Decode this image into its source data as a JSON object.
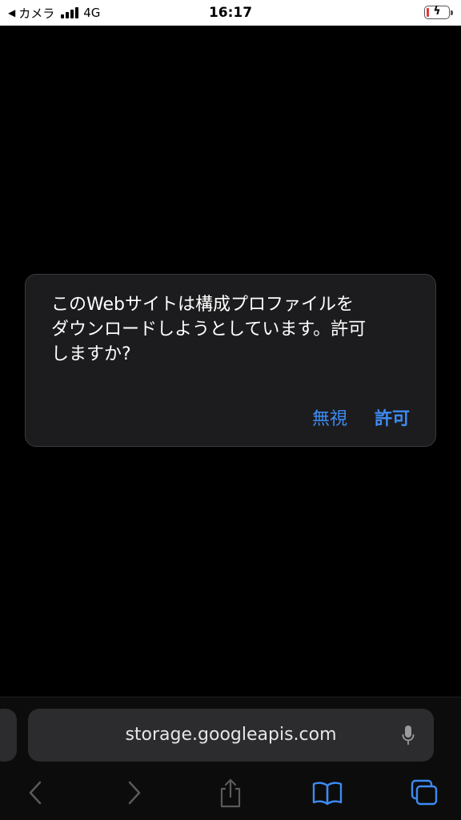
{
  "status_bar": {
    "back_glyph": "◀",
    "carrier": "カメラ",
    "network": "4G",
    "time": "16:17",
    "battery_level": 0.1,
    "charging": true
  },
  "dialog": {
    "message_lines": [
      "このWebサイトは構成プロファイルを",
      "ダウンロードしようとしています。許可",
      "しますか?"
    ],
    "ignore_label": "無視",
    "allow_label": "許可"
  },
  "browser": {
    "url": "storage.googleapis.com"
  },
  "toolbar": {
    "buttons": [
      "back-icon",
      "forward-icon",
      "share-icon",
      "bookmarks-icon",
      "tabs-icon"
    ]
  },
  "colors": {
    "accent": "#3d8bf2",
    "dialog_bg": "#1c1c1e",
    "battery_low": "#e5383b"
  }
}
